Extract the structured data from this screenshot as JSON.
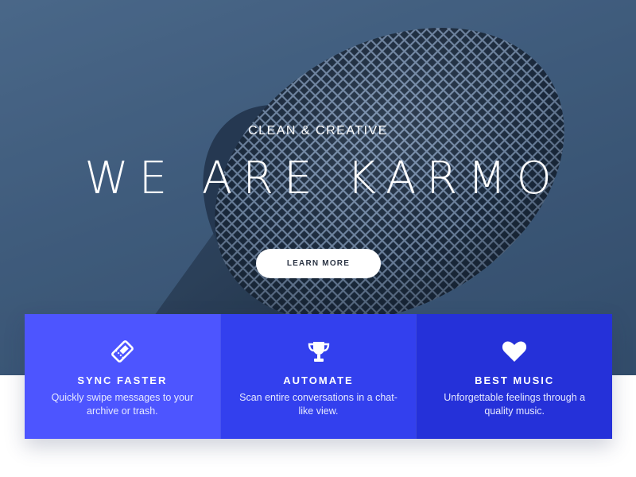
{
  "hero": {
    "tagline": "CLEAN & CREATIVE",
    "title": "WE ARE KARMO",
    "button_label": "LEARN MORE",
    "background_color": "#3f5b7a"
  },
  "features": [
    {
      "title": "SYNC FASTER",
      "description": "Quickly swipe messages to your archive or trash.",
      "icon": "ticket-icon",
      "color": "#4d55ff"
    },
    {
      "title": "AUTOMATE",
      "description": "Scan entire conversations in a chat-like view.",
      "icon": "trophy-icon",
      "color": "#3340ee"
    },
    {
      "title": "BEST MUSIC",
      "description": "Unforgettable feelings through a quality music.",
      "icon": "heart-icon",
      "color": "#2531d9"
    }
  ]
}
